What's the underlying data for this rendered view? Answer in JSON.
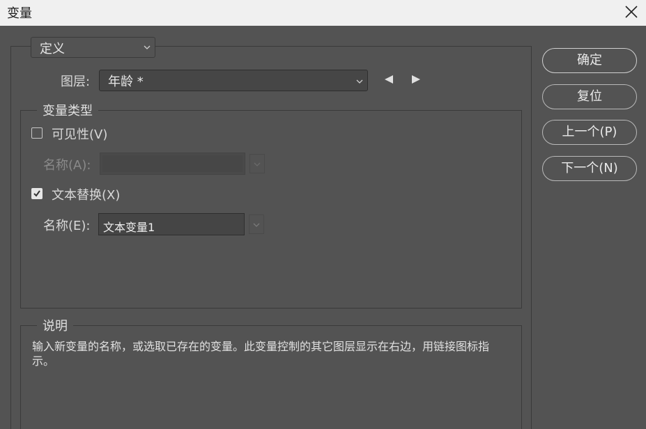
{
  "window": {
    "title": "变量"
  },
  "mode_dropdown": {
    "selected": "定义"
  },
  "layer": {
    "label": "图层:",
    "selected": "年龄 *"
  },
  "variable_type": {
    "legend": "变量类型",
    "visibility": {
      "label": "可见性(V)",
      "checked": false,
      "name_label": "名称(A):",
      "name_value": ""
    },
    "text_replace": {
      "label": "文本替换(X)",
      "checked": true,
      "name_label": "名称(E):",
      "name_value": "文本变量1"
    }
  },
  "description": {
    "legend": "说明",
    "text": "输入新变量的名称，或选取已存在的变量。此变量控制的其它图层显示在右边，用链接图标指示。"
  },
  "buttons": {
    "ok": "确定",
    "reset": "复位",
    "previous": "上一个(P)",
    "next": "下一个(N)"
  },
  "icons": {
    "close": "close-icon",
    "prev_arrow": "triangle-left-icon",
    "next_arrow": "triangle-right-icon",
    "chevron": "chevron-down-icon",
    "check": "checkmark-icon"
  }
}
